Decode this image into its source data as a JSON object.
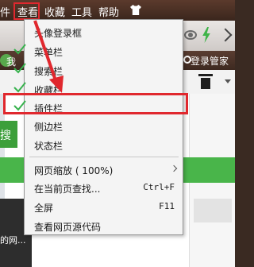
{
  "menubar": {
    "partial_label": "件",
    "view_label": "查看",
    "favorites_label": "收藏",
    "tools_label": "工具",
    "help_label": "帮助"
  },
  "bookmarks": {
    "left_text": "我",
    "login_text": "登录管家"
  },
  "page": {
    "search_fragment": "搜",
    "dark_caption": "的网..."
  },
  "view_menu": {
    "items": [
      {
        "label": "头像登录框",
        "checked": false
      },
      {
        "label": "菜单栏",
        "checked": true
      },
      {
        "label": "搜索栏",
        "checked": true
      },
      {
        "label": "收藏栏",
        "checked": true
      },
      {
        "label": "插件栏",
        "checked": true
      },
      {
        "label": "侧边栏",
        "checked": false
      },
      {
        "label": "状态栏",
        "checked": false
      },
      {
        "label": "网页缩放 ( 100%)",
        "checked": false,
        "submenu": true
      },
      {
        "label": "在当前页查找...",
        "checked": false,
        "shortcut": "Ctrl+F"
      },
      {
        "label": "全屏",
        "checked": false,
        "shortcut": "F11"
      },
      {
        "label": "查看网页源代码",
        "checked": false
      }
    ]
  },
  "colors": {
    "accent_red": "#e0282e",
    "check_green": "#37b24d"
  }
}
